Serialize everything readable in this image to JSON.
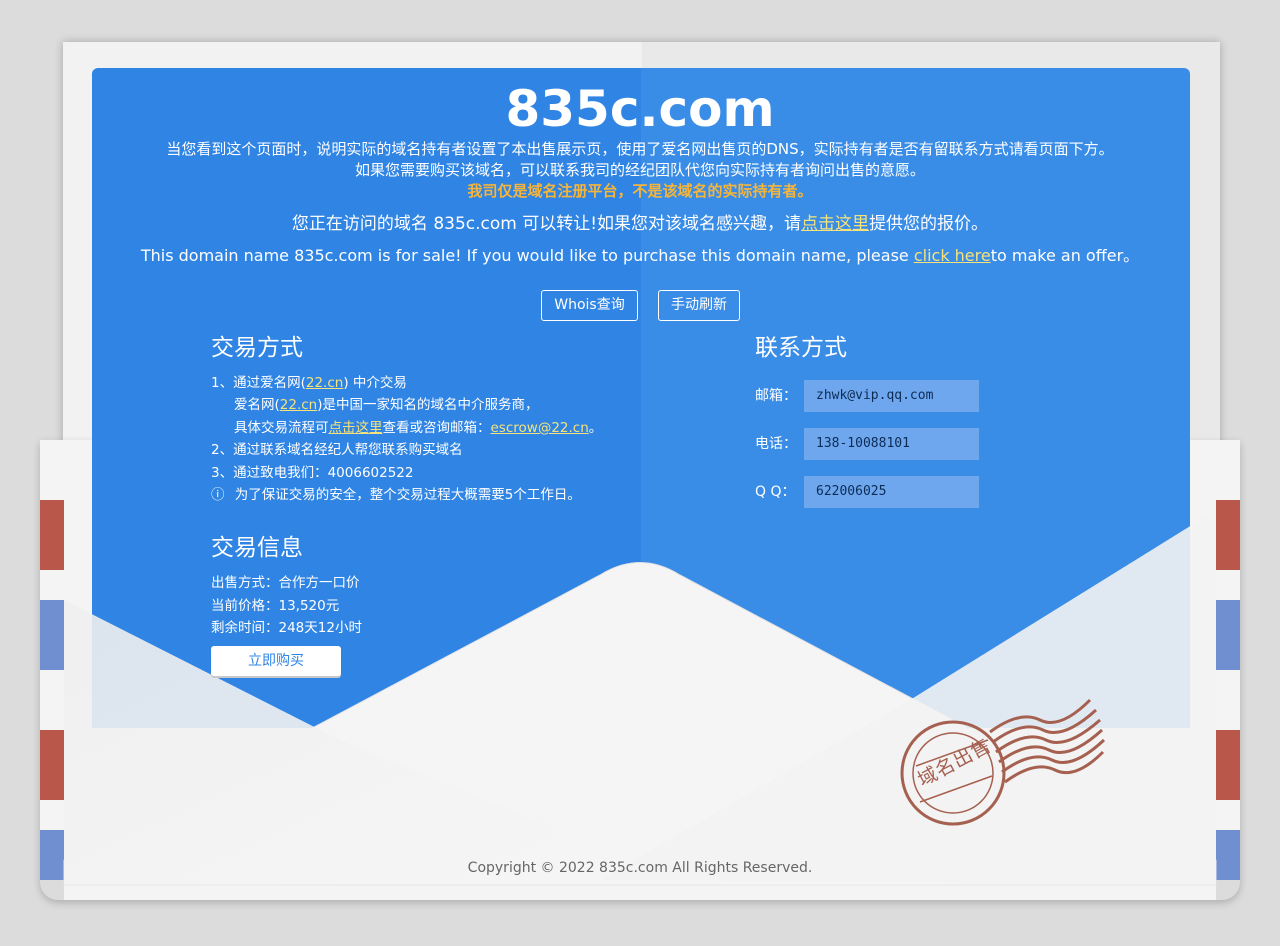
{
  "domain_title": "835c.com",
  "notice": {
    "line1": "当您看到这个页面时，说明实际的域名持有者设置了本出售展示页，使用了爱名网出售页的DNS，实际持有者是否有留联系方式请看页面下方。",
    "line2": "如果您需要购买该域名，可以联系我司的经纪团队代您向实际持有者询问出售的意愿。",
    "warning": "我司仅是域名注册平台，不是该域名的实际持有者。"
  },
  "offer_cn": {
    "before": "您正在访问的域名 835c.com 可以转让!如果您对该域名感兴趣，请",
    "link": "点击这里",
    "after": "提供您的报价。"
  },
  "offer_en": {
    "before": "This domain name 835c.com is for sale! If you would like to purchase this domain name, please ",
    "link": "click here",
    "after": "to make an offer。"
  },
  "buttons": {
    "whois": "Whois查询",
    "refresh": "手动刷新",
    "buy": "立即购买"
  },
  "trade_method": {
    "heading": "交易方式",
    "item1_prefix": "1、通过爱名网(",
    "item1_link": "22.cn",
    "item1_suffix": ") 中介交易",
    "item1b_prefix": "爱名网(",
    "item1b_link": "22.cn",
    "item1b_suffix": ")是中国一家知名的域名中介服务商，",
    "item1c_prefix": "具体交易流程可",
    "item1c_link": "点击这里",
    "item1c_mid": "查看或咨询邮箱：",
    "item1c_email": "escrow@22.cn",
    "item1c_end": "。",
    "item2": "2、通过联系域名经纪人帮您联系购买域名",
    "item3": "3、通过致电我们：4006602522",
    "notice_icon": "ⓘ",
    "notice": "为了保证交易的安全，整个交易过程大概需要5个工作日。"
  },
  "trade_info": {
    "heading": "交易信息",
    "sale_method": "出售方式：合作方一口价",
    "price": "当前价格：13,520元",
    "remaining": "剩余时间：248天12小时"
  },
  "contact": {
    "heading": "联系方式",
    "email_label": "邮箱：",
    "email_value": "zhwk@vip.qq.com",
    "phone_label": "电话：",
    "phone_value": "138-10088101",
    "qq_label": "Q Q：",
    "qq_value": "622006025"
  },
  "stamp_text": "域名出售",
  "copyright": "Copyright © 2022 835c.com All Rights Reserved.",
  "colors": {
    "letter_blue": "#2f84e4",
    "link_yellow": "#f6e27a",
    "warning_orange": "#f5b53a",
    "stamp_brown": "#a56050",
    "stripe_red": "#b9584a",
    "stripe_blue": "#6f8fd0"
  }
}
